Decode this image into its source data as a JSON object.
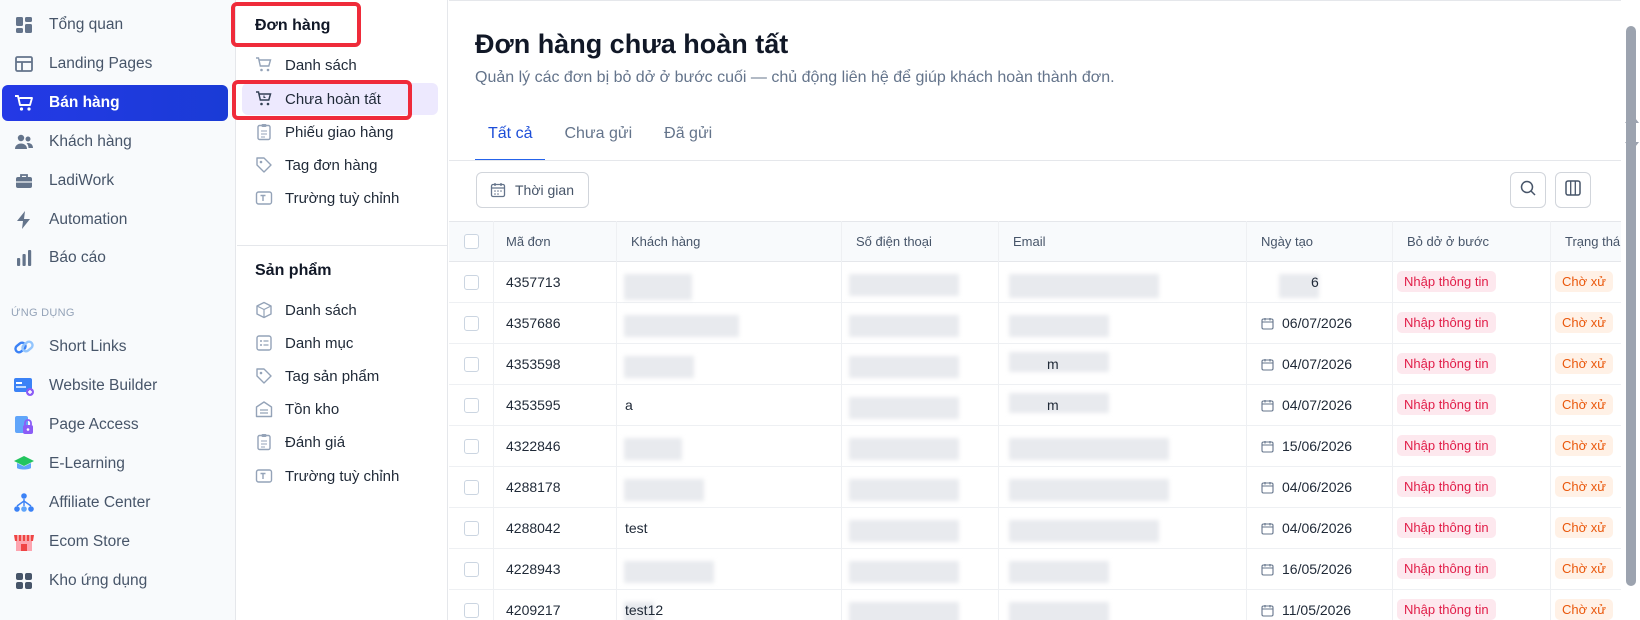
{
  "nav": {
    "items": [
      {
        "label": "Tổng quan",
        "icon": "grid-icon"
      },
      {
        "label": "Landing Pages",
        "icon": "layout-icon"
      },
      {
        "label": "Bán hàng",
        "icon": "cart-icon",
        "active": true
      },
      {
        "label": "Khách hàng",
        "icon": "users-icon"
      },
      {
        "label": "LadiWork",
        "icon": "briefcase-icon"
      },
      {
        "label": "Automation",
        "icon": "lightning-icon"
      },
      {
        "label": "Báo cáo",
        "icon": "bar-chart-icon"
      }
    ],
    "section_label": "ỨNG DỤNG",
    "apps": [
      {
        "label": "Short Links",
        "icon": "link-icon"
      },
      {
        "label": "Website Builder",
        "icon": "website-icon"
      },
      {
        "label": "Page Access",
        "icon": "lock-icon"
      },
      {
        "label": "E-Learning",
        "icon": "graduation-icon"
      },
      {
        "label": "Affiliate Center",
        "icon": "network-icon"
      },
      {
        "label": "Ecom Store",
        "icon": "store-icon"
      },
      {
        "label": "Kho ứng dụng",
        "icon": "apps-icon"
      }
    ],
    "accent_color": "#1d3be0"
  },
  "subnav": {
    "orders_title": "Đơn hàng",
    "orders_items": [
      {
        "label": "Danh sách",
        "icon": "cart-outline-icon"
      },
      {
        "label": "Chưa hoàn tất",
        "icon": "cart-clock-icon",
        "active": true
      },
      {
        "label": "Phiếu giao hàng",
        "icon": "clipboard-icon"
      },
      {
        "label": "Tag đơn hàng",
        "icon": "tag-icon"
      },
      {
        "label": "Trường tuỳ chỉnh",
        "icon": "text-field-icon"
      }
    ],
    "products_title": "Sản phẩm",
    "products_items": [
      {
        "label": "Danh sách",
        "icon": "box-icon"
      },
      {
        "label": "Danh mục",
        "icon": "category-icon"
      },
      {
        "label": "Tag sản phẩm",
        "icon": "tag-icon"
      },
      {
        "label": "Tồn kho",
        "icon": "warehouse-icon"
      },
      {
        "label": "Đánh giá",
        "icon": "clipboard-icon"
      },
      {
        "label": "Trường tuỳ chỉnh",
        "icon": "text-field-icon"
      }
    ]
  },
  "main": {
    "title": "Đơn hàng chưa hoàn tất",
    "subtitle": "Quản lý các đơn bị bỏ dở ở bước cuối — chủ động liên hệ để giúp khách hoàn thành đơn.",
    "tabs": [
      {
        "label": "Tất cả",
        "active": true
      },
      {
        "label": "Chưa gửi"
      },
      {
        "label": "Đã gửi"
      }
    ],
    "filter_label": "Thời gian",
    "columns": [
      "Mã đơn",
      "Khách hàng",
      "Số điện thoại",
      "Email",
      "Ngày tạo",
      "Bỏ dở ở bước",
      "Trạng thá"
    ],
    "rows": [
      {
        "id": "4357713",
        "customer": "",
        "phone": "",
        "email": "",
        "date": "6",
        "step": "Nhập thông tin",
        "status": "Chờ xử"
      },
      {
        "id": "4357686",
        "customer": "",
        "phone": "",
        "email": "",
        "date": "06/07/2026",
        "step": "Nhập thông tin",
        "status": "Chờ xử"
      },
      {
        "id": "4353598",
        "customer": "",
        "phone": "",
        "email": "m",
        "date": "04/07/2026",
        "step": "Nhập thông tin",
        "status": "Chờ xử"
      },
      {
        "id": "4353595",
        "customer": "a",
        "phone": "",
        "email": "m",
        "date": "04/07/2026",
        "step": "Nhập thông tin",
        "status": "Chờ xử"
      },
      {
        "id": "4322846",
        "customer": "",
        "phone": "",
        "email": "",
        "date": "15/06/2026",
        "step": "Nhập thông tin",
        "status": "Chờ xử"
      },
      {
        "id": "4288178",
        "customer": "",
        "phone": "",
        "email": "",
        "date": "04/06/2026",
        "step": "Nhập thông tin",
        "status": "Chờ xử"
      },
      {
        "id": "4288042",
        "customer": "test",
        "phone": "",
        "email": "",
        "date": "04/06/2026",
        "step": "Nhập thông tin",
        "status": "Chờ xử"
      },
      {
        "id": "4228943",
        "customer": "",
        "phone": "",
        "email": "",
        "date": "16/05/2026",
        "step": "Nhập thông tin",
        "status": "Chờ xử"
      },
      {
        "id": "4209217",
        "customer": "test12",
        "phone": "",
        "email": "",
        "date": "11/05/2026",
        "step": "Nhập thông tin",
        "status": "Chờ xử"
      }
    ],
    "badge_red_color": "#e11d48",
    "badge_orange_color": "#ea580c"
  }
}
